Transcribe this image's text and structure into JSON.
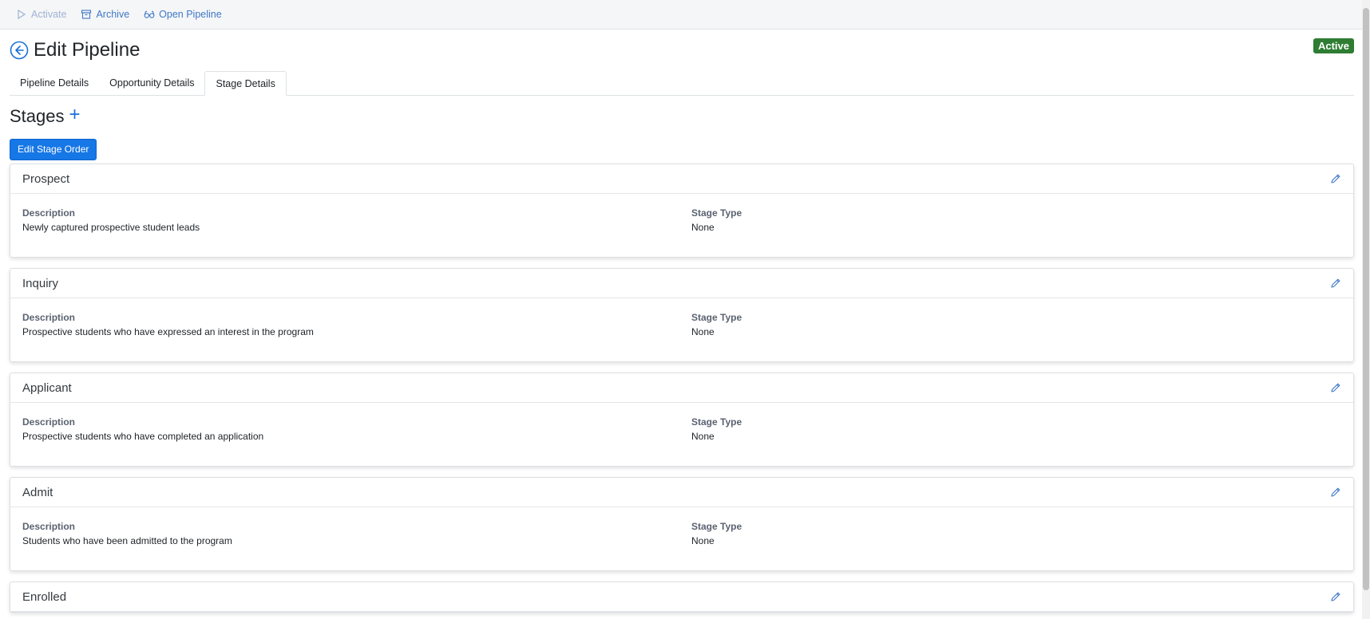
{
  "toolbar": {
    "activate": "Activate",
    "archive": "Archive",
    "open_pipeline": "Open Pipeline"
  },
  "header": {
    "title": "Edit Pipeline",
    "status": "Active"
  },
  "tabs": [
    {
      "label": "Pipeline Details"
    },
    {
      "label": "Opportunity Details"
    },
    {
      "label": "Stage Details"
    }
  ],
  "stages_section": {
    "title": "Stages",
    "add_symbol": "+",
    "edit_order_label": "Edit Stage Order"
  },
  "stages": [
    {
      "name": "Prospect",
      "description_label": "Description",
      "description": "Newly captured prospective student leads",
      "type_label": "Stage Type",
      "type": "None"
    },
    {
      "name": "Inquiry",
      "description_label": "Description",
      "description": "Prospective students who have expressed an interest in the program",
      "type_label": "Stage Type",
      "type": "None"
    },
    {
      "name": "Applicant",
      "description_label": "Description",
      "description": "Prospective students who have completed an application",
      "type_label": "Stage Type",
      "type": "None"
    },
    {
      "name": "Admit",
      "description_label": "Description",
      "description": "Students who have been admitted to the program",
      "type_label": "Stage Type",
      "type": "None"
    },
    {
      "name": "Enrolled"
    }
  ],
  "colors": {
    "accent": "#1677e6",
    "link": "#3f78c8",
    "status_active": "#2e7d32"
  }
}
